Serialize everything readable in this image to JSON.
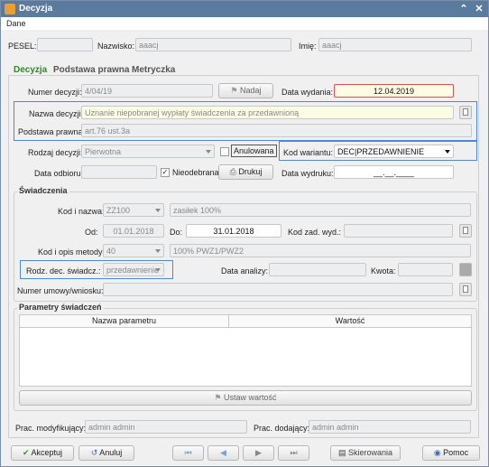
{
  "window": {
    "title": "Decyzja"
  },
  "menu": {
    "dane": "Dane"
  },
  "top": {
    "pesel_label": "PESEL:",
    "nazwisko_label": "Nazwisko:",
    "nazwisko": "aaacj",
    "imie_label": "Imię:",
    "imie": "aaacj"
  },
  "tabs": [
    "Decyzja",
    "Podstawa prawna",
    "Metryczka"
  ],
  "dec": {
    "numer_label": "Numer decyzji:",
    "numer": "4/04/19",
    "nadaj": "Nadaj",
    "data_wyd_label": "Data wydania:",
    "data_wyd": "12.04.2019",
    "nazwa_label": "Nazwa decyzji:",
    "nazwa": "Uznanie niepobranej wypłaty świadczenia za przedawnioną",
    "podstawa_label": "Podstawa prawna:",
    "podstawa": "art.76 ust.3a",
    "rodzaj_label": "Rodzaj decyzji:",
    "rodzaj": "Pierwotna",
    "anulowana": "Anulowana",
    "kod_war_label": "Kod wariantu:",
    "kod_war": "DEC|PRZEDAWNIENIE",
    "odbior_label": "Data odbioru:",
    "nieodebrana": "Nieodebrana",
    "drukuj": "Drukuj",
    "wydruk_label": "Data wydruku:",
    "wydruk": "__.__.____"
  },
  "sw": {
    "title": "Świadczenia",
    "kod_label": "Kod i nazwa:",
    "kod": "ZZ100",
    "nazwa": "zasiłek 100%",
    "od_label": "Od:",
    "od": "01.01.2018",
    "do_label": "Do:",
    "do": "31.01.2018",
    "kodzad_label": "Kod zad. wyd.:",
    "metoda_label": "Kod i opis metody:",
    "metoda": "40",
    "metoda_opis": "100% PWZ1/PWZ2",
    "rodz_label": "Rodz. dec. świadcz.:",
    "rodz": "przedawnienie",
    "analizy_label": "Data analizy:",
    "kwota_label": "Kwota:",
    "umowa_label": "Numer umowy/wniosku:"
  },
  "param": {
    "title": "Parametry świadczeń",
    "col1": "Nazwa parametru",
    "col2": "Wartość",
    "ustaw": "Ustaw wartość"
  },
  "bottom": {
    "mod_label": "Prac. modyfikujący:",
    "mod": "admin admin",
    "dod_label": "Prac. dodający:",
    "dod": "admin admin"
  },
  "footer": {
    "akceptuj": "Akceptuj",
    "anuluj": "Anuluj",
    "skierowania": "Skierowania",
    "pomoc": "Pomoc"
  }
}
